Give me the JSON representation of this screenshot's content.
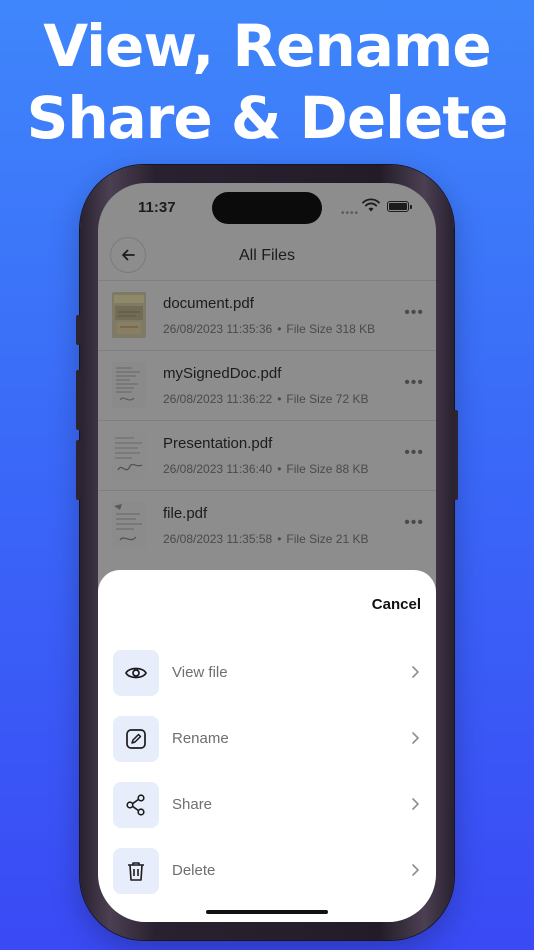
{
  "headline": {
    "line1": "View, Rename",
    "line2": "Share & Delete"
  },
  "status_bar": {
    "time": "11:37",
    "icons": [
      "signal-icon",
      "wifi-icon",
      "battery-icon"
    ]
  },
  "navbar": {
    "title": "All Files",
    "back_icon": "arrow-left-icon"
  },
  "files": [
    {
      "name": "document.pdf",
      "date": "26/08/2023 11:35:36",
      "size": "File Size 318 KB"
    },
    {
      "name": "mySignedDoc.pdf",
      "date": "26/08/2023 11:36:22",
      "size": "File Size 72 KB"
    },
    {
      "name": "Presentation.pdf",
      "date": "26/08/2023 11:36:40",
      "size": "File Size 88 KB"
    },
    {
      "name": "file.pdf",
      "date": "26/08/2023 11:35:58",
      "size": "File Size 21 KB"
    }
  ],
  "meta_separator": "•",
  "more_glyph": "•••",
  "sheet": {
    "cancel_label": "Cancel",
    "actions": [
      {
        "label": "View file",
        "icon": "eye-icon"
      },
      {
        "label": "Rename",
        "icon": "edit-icon"
      },
      {
        "label": "Share",
        "icon": "share-icon"
      },
      {
        "label": "Delete",
        "icon": "trash-icon"
      }
    ]
  },
  "colors": {
    "background_top": "#3f86fb",
    "background_bottom": "#3a4af5",
    "icon_tile": "#e7edfb",
    "overlay_screen": "#8d8d8d"
  }
}
